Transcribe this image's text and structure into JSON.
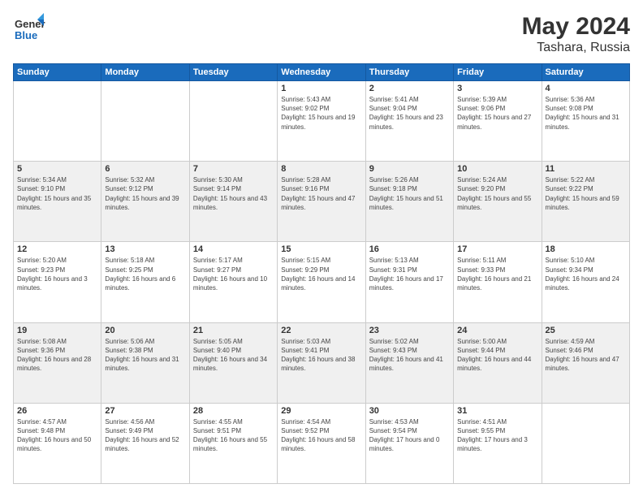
{
  "logo": {
    "line1": "General",
    "line2": "Blue"
  },
  "header": {
    "month_year": "May 2024",
    "location": "Tashara, Russia"
  },
  "weekdays": [
    "Sunday",
    "Monday",
    "Tuesday",
    "Wednesday",
    "Thursday",
    "Friday",
    "Saturday"
  ],
  "weeks": [
    [
      {
        "day": "",
        "sunrise": "",
        "sunset": "",
        "daylight": ""
      },
      {
        "day": "",
        "sunrise": "",
        "sunset": "",
        "daylight": ""
      },
      {
        "day": "",
        "sunrise": "",
        "sunset": "",
        "daylight": ""
      },
      {
        "day": "1",
        "sunrise": "Sunrise: 5:43 AM",
        "sunset": "Sunset: 9:02 PM",
        "daylight": "Daylight: 15 hours and 19 minutes."
      },
      {
        "day": "2",
        "sunrise": "Sunrise: 5:41 AM",
        "sunset": "Sunset: 9:04 PM",
        "daylight": "Daylight: 15 hours and 23 minutes."
      },
      {
        "day": "3",
        "sunrise": "Sunrise: 5:39 AM",
        "sunset": "Sunset: 9:06 PM",
        "daylight": "Daylight: 15 hours and 27 minutes."
      },
      {
        "day": "4",
        "sunrise": "Sunrise: 5:36 AM",
        "sunset": "Sunset: 9:08 PM",
        "daylight": "Daylight: 15 hours and 31 minutes."
      }
    ],
    [
      {
        "day": "5",
        "sunrise": "Sunrise: 5:34 AM",
        "sunset": "Sunset: 9:10 PM",
        "daylight": "Daylight: 15 hours and 35 minutes."
      },
      {
        "day": "6",
        "sunrise": "Sunrise: 5:32 AM",
        "sunset": "Sunset: 9:12 PM",
        "daylight": "Daylight: 15 hours and 39 minutes."
      },
      {
        "day": "7",
        "sunrise": "Sunrise: 5:30 AM",
        "sunset": "Sunset: 9:14 PM",
        "daylight": "Daylight: 15 hours and 43 minutes."
      },
      {
        "day": "8",
        "sunrise": "Sunrise: 5:28 AM",
        "sunset": "Sunset: 9:16 PM",
        "daylight": "Daylight: 15 hours and 47 minutes."
      },
      {
        "day": "9",
        "sunrise": "Sunrise: 5:26 AM",
        "sunset": "Sunset: 9:18 PM",
        "daylight": "Daylight: 15 hours and 51 minutes."
      },
      {
        "day": "10",
        "sunrise": "Sunrise: 5:24 AM",
        "sunset": "Sunset: 9:20 PM",
        "daylight": "Daylight: 15 hours and 55 minutes."
      },
      {
        "day": "11",
        "sunrise": "Sunrise: 5:22 AM",
        "sunset": "Sunset: 9:22 PM",
        "daylight": "Daylight: 15 hours and 59 minutes."
      }
    ],
    [
      {
        "day": "12",
        "sunrise": "Sunrise: 5:20 AM",
        "sunset": "Sunset: 9:23 PM",
        "daylight": "Daylight: 16 hours and 3 minutes."
      },
      {
        "day": "13",
        "sunrise": "Sunrise: 5:18 AM",
        "sunset": "Sunset: 9:25 PM",
        "daylight": "Daylight: 16 hours and 6 minutes."
      },
      {
        "day": "14",
        "sunrise": "Sunrise: 5:17 AM",
        "sunset": "Sunset: 9:27 PM",
        "daylight": "Daylight: 16 hours and 10 minutes."
      },
      {
        "day": "15",
        "sunrise": "Sunrise: 5:15 AM",
        "sunset": "Sunset: 9:29 PM",
        "daylight": "Daylight: 16 hours and 14 minutes."
      },
      {
        "day": "16",
        "sunrise": "Sunrise: 5:13 AM",
        "sunset": "Sunset: 9:31 PM",
        "daylight": "Daylight: 16 hours and 17 minutes."
      },
      {
        "day": "17",
        "sunrise": "Sunrise: 5:11 AM",
        "sunset": "Sunset: 9:33 PM",
        "daylight": "Daylight: 16 hours and 21 minutes."
      },
      {
        "day": "18",
        "sunrise": "Sunrise: 5:10 AM",
        "sunset": "Sunset: 9:34 PM",
        "daylight": "Daylight: 16 hours and 24 minutes."
      }
    ],
    [
      {
        "day": "19",
        "sunrise": "Sunrise: 5:08 AM",
        "sunset": "Sunset: 9:36 PM",
        "daylight": "Daylight: 16 hours and 28 minutes."
      },
      {
        "day": "20",
        "sunrise": "Sunrise: 5:06 AM",
        "sunset": "Sunset: 9:38 PM",
        "daylight": "Daylight: 16 hours and 31 minutes."
      },
      {
        "day": "21",
        "sunrise": "Sunrise: 5:05 AM",
        "sunset": "Sunset: 9:40 PM",
        "daylight": "Daylight: 16 hours and 34 minutes."
      },
      {
        "day": "22",
        "sunrise": "Sunrise: 5:03 AM",
        "sunset": "Sunset: 9:41 PM",
        "daylight": "Daylight: 16 hours and 38 minutes."
      },
      {
        "day": "23",
        "sunrise": "Sunrise: 5:02 AM",
        "sunset": "Sunset: 9:43 PM",
        "daylight": "Daylight: 16 hours and 41 minutes."
      },
      {
        "day": "24",
        "sunrise": "Sunrise: 5:00 AM",
        "sunset": "Sunset: 9:44 PM",
        "daylight": "Daylight: 16 hours and 44 minutes."
      },
      {
        "day": "25",
        "sunrise": "Sunrise: 4:59 AM",
        "sunset": "Sunset: 9:46 PM",
        "daylight": "Daylight: 16 hours and 47 minutes."
      }
    ],
    [
      {
        "day": "26",
        "sunrise": "Sunrise: 4:57 AM",
        "sunset": "Sunset: 9:48 PM",
        "daylight": "Daylight: 16 hours and 50 minutes."
      },
      {
        "day": "27",
        "sunrise": "Sunrise: 4:56 AM",
        "sunset": "Sunset: 9:49 PM",
        "daylight": "Daylight: 16 hours and 52 minutes."
      },
      {
        "day": "28",
        "sunrise": "Sunrise: 4:55 AM",
        "sunset": "Sunset: 9:51 PM",
        "daylight": "Daylight: 16 hours and 55 minutes."
      },
      {
        "day": "29",
        "sunrise": "Sunrise: 4:54 AM",
        "sunset": "Sunset: 9:52 PM",
        "daylight": "Daylight: 16 hours and 58 minutes."
      },
      {
        "day": "30",
        "sunrise": "Sunrise: 4:53 AM",
        "sunset": "Sunset: 9:54 PM",
        "daylight": "Daylight: 17 hours and 0 minutes."
      },
      {
        "day": "31",
        "sunrise": "Sunrise: 4:51 AM",
        "sunset": "Sunset: 9:55 PM",
        "daylight": "Daylight: 17 hours and 3 minutes."
      },
      {
        "day": "",
        "sunrise": "",
        "sunset": "",
        "daylight": ""
      }
    ]
  ]
}
